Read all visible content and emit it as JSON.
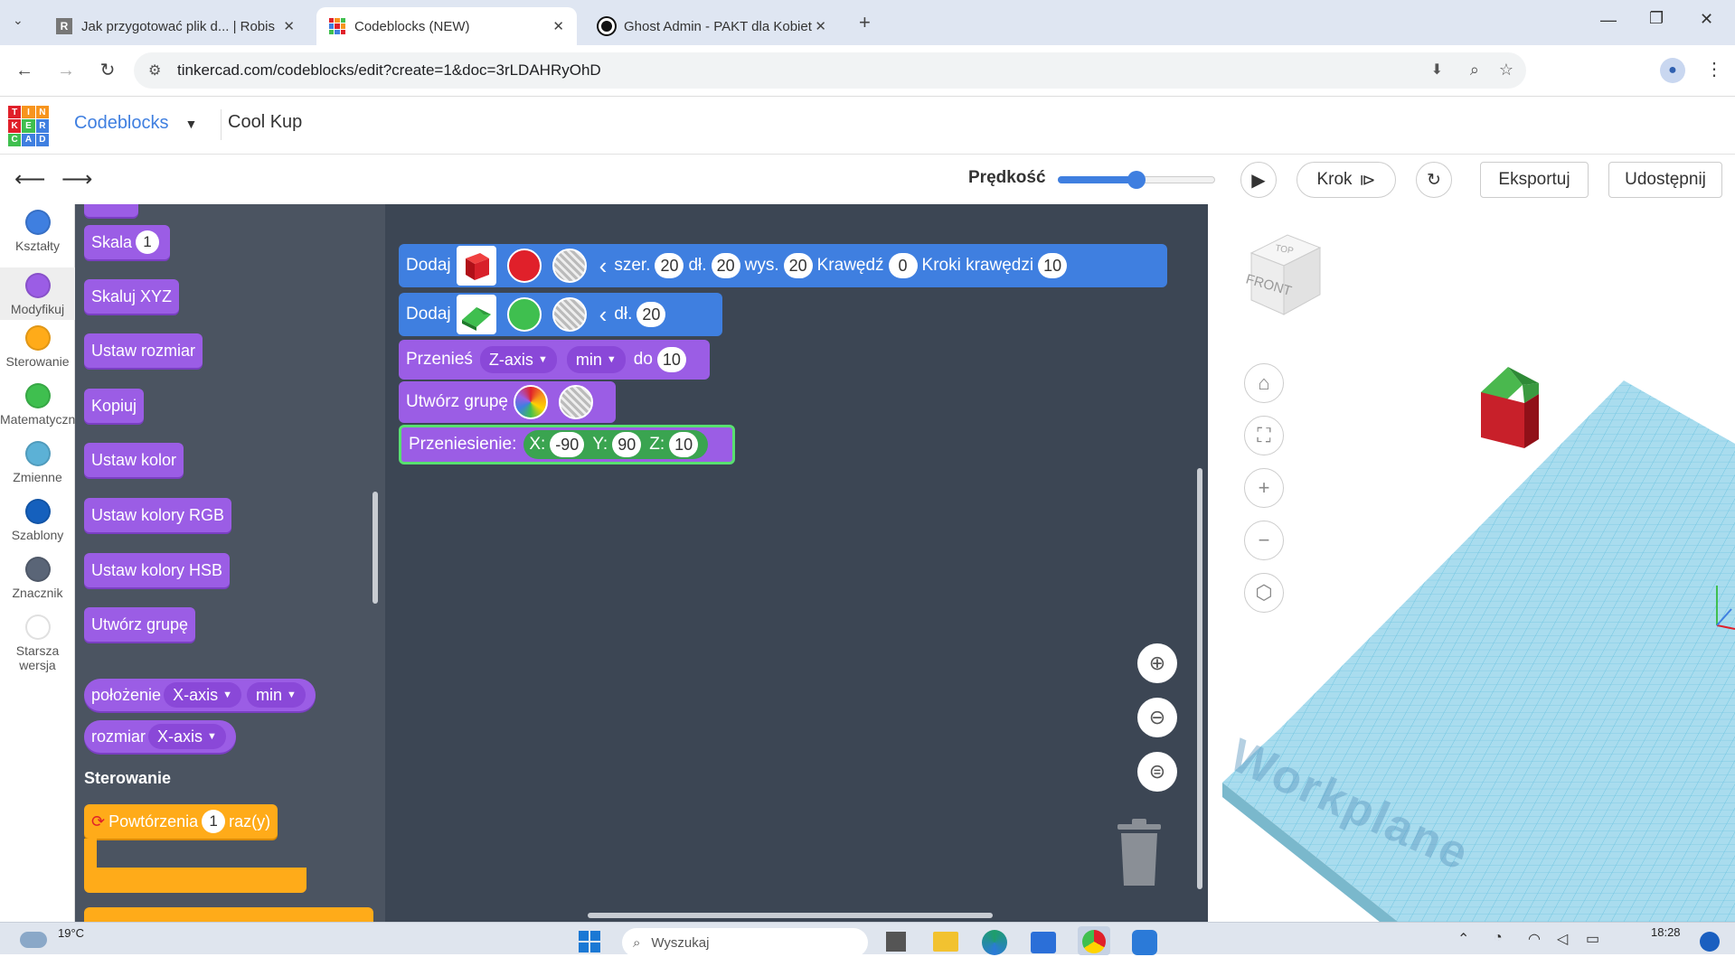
{
  "browser": {
    "tabs": [
      {
        "title": "Jak przygotować plik d... | Robis",
        "active": false
      },
      {
        "title": "Codeblocks (NEW)",
        "active": true
      },
      {
        "title": "Ghost Admin - PAKT dla Kobiet",
        "active": false
      }
    ],
    "url": "tinkercad.com/codeblocks/edit?create=1&doc=3rLDAHRyOhD"
  },
  "header": {
    "logo_letters": [
      "T",
      "I",
      "N",
      "K",
      "E",
      "R",
      "C",
      "A",
      "D"
    ],
    "app_name": "Codeblocks",
    "design_name": "Cool Kup"
  },
  "toolbar": {
    "speed_label": "Prędkość",
    "speed_value": 0.5,
    "step_label": "Krok",
    "export_label": "Eksportuj",
    "share_label": "Udostępnij"
  },
  "categories": [
    {
      "label": "Kształty",
      "color": "#3f7fe0"
    },
    {
      "label": "Modyfikuj",
      "color": "#9b5de5"
    },
    {
      "label": "Sterowanie",
      "color": "#ffab19"
    },
    {
      "label": "Matematyczne",
      "color": "#3fbf4f"
    },
    {
      "label": "Zmienne",
      "color": "#5cb1d6"
    },
    {
      "label": "Szablony",
      "color": "#1560bd"
    },
    {
      "label": "Znacznik",
      "color": "#5a6577"
    },
    {
      "label": "Starsza wersja",
      "color": "#ffffff"
    }
  ],
  "palette": {
    "scale_label": "Skala",
    "scale_value": "1",
    "scale_xyz_label": "Skaluj XYZ",
    "set_size_label": "Ustaw rozmiar",
    "copy_label": "Kopiuj",
    "set_color_label": "Ustaw kolor",
    "set_rgb_label": "Ustaw kolory RGB",
    "set_hsb_label": "Ustaw kolory HSB",
    "group_label": "Utwórz grupę",
    "position_label": "położenie",
    "position_axis": "X-axis",
    "position_mode": "min",
    "size_label": "rozmiar",
    "size_axis": "X-axis",
    "control_heading": "Sterowanie",
    "repeat_label": "Powtórzenia",
    "repeat_value": "1",
    "repeat_suffix": "raz(y)"
  },
  "workspace": {
    "block1": {
      "label": "Dodaj",
      "w_label": "szer.",
      "w": "20",
      "l_label": "dł.",
      "l": "20",
      "h_label": "wys.",
      "h": "20",
      "edge_label": "Krawędź",
      "edge": "0",
      "steps_label": "Kroki krawędzi",
      "steps": "10",
      "color": "#e0202a"
    },
    "block2": {
      "label": "Dodaj",
      "l_label": "dł.",
      "l": "20",
      "color": "#3fbf4f"
    },
    "block3": {
      "label": "Przenieś",
      "axis": "Z-axis",
      "mode": "min",
      "to_label": "do",
      "value": "10"
    },
    "block4": {
      "label": "Utwórz grupę"
    },
    "block5": {
      "label": "Przeniesienie:",
      "x_label": "X:",
      "x": "-90",
      "y_label": "Y:",
      "y": "90",
      "z_label": "Z:",
      "z": "10"
    }
  },
  "viewcube": {
    "top": "TOP",
    "front": "FRONT"
  },
  "workplane_label": "Workplane",
  "taskbar": {
    "temperature": "19°C",
    "search_placeholder": "Wyszukaj",
    "time": "18:28"
  }
}
